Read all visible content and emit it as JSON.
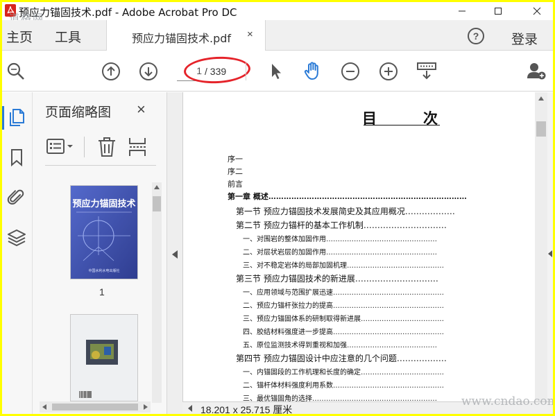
{
  "window": {
    "title": "预应力锚固技术.pdf - Adobe Acrobat Pro DC",
    "watermark_top": "道格网",
    "watermark_bottom": "www.cndao.com"
  },
  "menu": {
    "home": "主页",
    "tools": "工具",
    "tab_label": "预应力锚固技术.pdf",
    "tab_close": "×",
    "help": "?",
    "login": "登录"
  },
  "toolbar": {
    "current_page": "1",
    "total_pages": "/ 339"
  },
  "thumbnails": {
    "title": "页面缩略图",
    "close": "×",
    "page_1_number": "1",
    "cover_title": "预应力锚固技术",
    "cover_subtitle": "中国水利水电出版社"
  },
  "document": {
    "title_left": "目",
    "title_right": "次",
    "toc": [
      {
        "text": "序一",
        "level": "front",
        "dots": ""
      },
      {
        "text": "序二",
        "level": "front",
        "dots": ""
      },
      {
        "text": "前言",
        "level": "front",
        "dots": ""
      },
      {
        "text": "第一章    概述",
        "level": "chapter",
        "dots": "……………………………………………………………………"
      },
      {
        "text": "第一节    预应力锚固技术发展简史及其应用概况",
        "level": "section",
        "dots": "………………"
      },
      {
        "text": "第二节    预应力锚杆的基本工作机制",
        "level": "section",
        "dots": "…………………………"
      },
      {
        "text": "一、对围岩的整体加固作用",
        "level": "item",
        "dots": "…………………………………………"
      },
      {
        "text": "二、对层状岩层的加固作用",
        "level": "item",
        "dots": "…………………………………………"
      },
      {
        "text": "三、对不稳定岩体的局部加固机理",
        "level": "item",
        "dots": "……………………………………"
      },
      {
        "text": "第三节    预应力锚固技术的新进展",
        "level": "section",
        "dots": "…………………………"
      },
      {
        "text": "一、应用领域与范围扩展迅速",
        "level": "item",
        "dots": "…………………………………………"
      },
      {
        "text": "二、预应力锚杆张拉力的提高",
        "level": "item",
        "dots": "…………………………………………"
      },
      {
        "text": "三、预应力锚固体系的研制取得新进展",
        "level": "item",
        "dots": "………………………………"
      },
      {
        "text": "四、胶结材料强度进一步提高",
        "level": "item",
        "dots": "…………………………………………"
      },
      {
        "text": "五、原位监测技术得到重视和加强",
        "level": "item",
        "dots": "…………………………………"
      },
      {
        "text": "第四节    预应力锚固设计中应注意的几个问题",
        "level": "section",
        "dots": "………………"
      },
      {
        "text": "一、内锚固段的工作机理和长度的确定",
        "level": "item",
        "dots": "………………………………"
      },
      {
        "text": "二、锚杆体材料强度利用系数",
        "level": "item",
        "dots": "…………………………………………"
      },
      {
        "text": "三、最优锚固角的选择",
        "level": "item",
        "dots": "………………………………………………"
      }
    ]
  },
  "status": {
    "dimensions": "18.201 x 25.715 厘米"
  },
  "colors": {
    "frame": "#ffff00",
    "accent_blue": "#2a7ad6",
    "annotation_red": "#e5232a",
    "cover_blue": "#2b3f9e"
  }
}
